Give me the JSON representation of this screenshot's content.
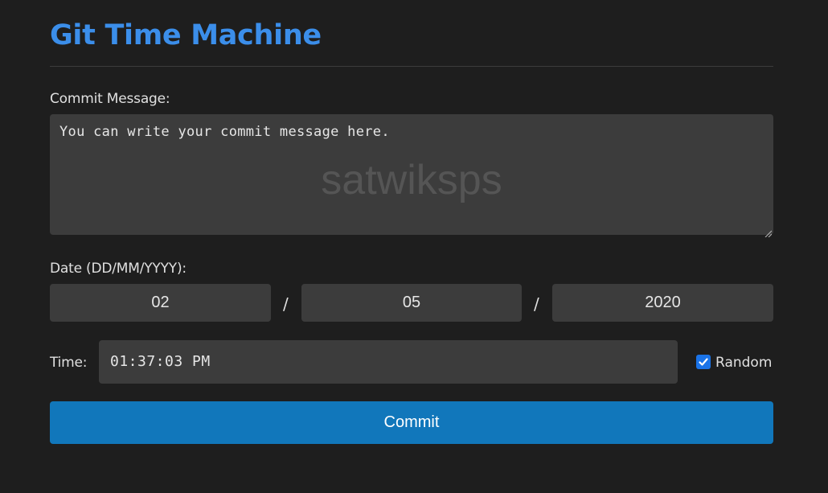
{
  "header": {
    "title": "Git Time Machine",
    "title_color": "#3b8eea"
  },
  "form": {
    "commit_message_label": "Commit Message:",
    "commit_message_value": "You can write your commit message here.",
    "watermark": "satwiksps",
    "date_label": "Date (DD/MM/YYYY):",
    "date": {
      "day": "02",
      "month": "05",
      "year": "2020",
      "separator": "/"
    },
    "time_label": "Time:",
    "time_value": "01:37:03 PM",
    "random_label": "Random",
    "random_checked": true,
    "commit_button": "Commit",
    "accent_color": "#1177bb"
  },
  "icons": {
    "checkbox": "checkmark-icon",
    "resize": "resize-handle-icon"
  }
}
